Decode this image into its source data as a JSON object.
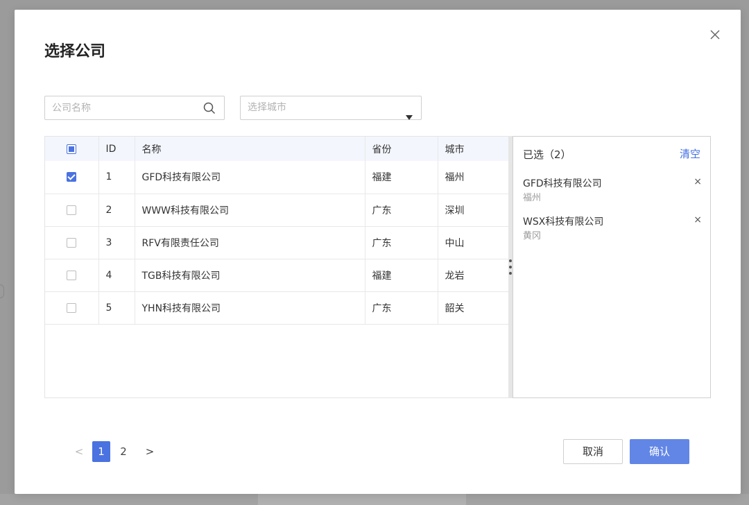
{
  "dialog": {
    "title": "选择公司"
  },
  "filters": {
    "company_placeholder": "公司名称",
    "city_placeholder": "选择城市"
  },
  "table": {
    "headers": {
      "id": "ID",
      "name": "名称",
      "province": "省份",
      "city": "城市"
    },
    "rows": [
      {
        "id": "1",
        "name": "GFD科技有限公司",
        "province": "福建",
        "city": "福州",
        "checked": true
      },
      {
        "id": "2",
        "name": "WWW科技有限公司",
        "province": "广东",
        "city": "深圳",
        "checked": false
      },
      {
        "id": "3",
        "name": "RFV有限责任公司",
        "province": "广东",
        "city": "中山",
        "checked": false
      },
      {
        "id": "4",
        "name": "TGB科技有限公司",
        "province": "福建",
        "city": "龙岩",
        "checked": false
      },
      {
        "id": "5",
        "name": "YHN科技有限公司",
        "province": "广东",
        "city": "韶关",
        "checked": false
      }
    ]
  },
  "selected": {
    "title": "已选（2）",
    "clear_label": "清空",
    "remove_glyph": "×",
    "items": [
      {
        "name": "GFD科技有限公司",
        "city": "福州"
      },
      {
        "name": "WSX科技有限公司",
        "city": "黄冈"
      }
    ]
  },
  "pagination": {
    "prev": "<",
    "next": ">",
    "pages": [
      "1",
      "2"
    ],
    "current": "1"
  },
  "actions": {
    "cancel_label": "取消",
    "confirm_label": "确认"
  },
  "colors": {
    "accent": "#4a72e0",
    "confirm_bg": "#6286e6",
    "header_bg": "#f3f6fd"
  }
}
